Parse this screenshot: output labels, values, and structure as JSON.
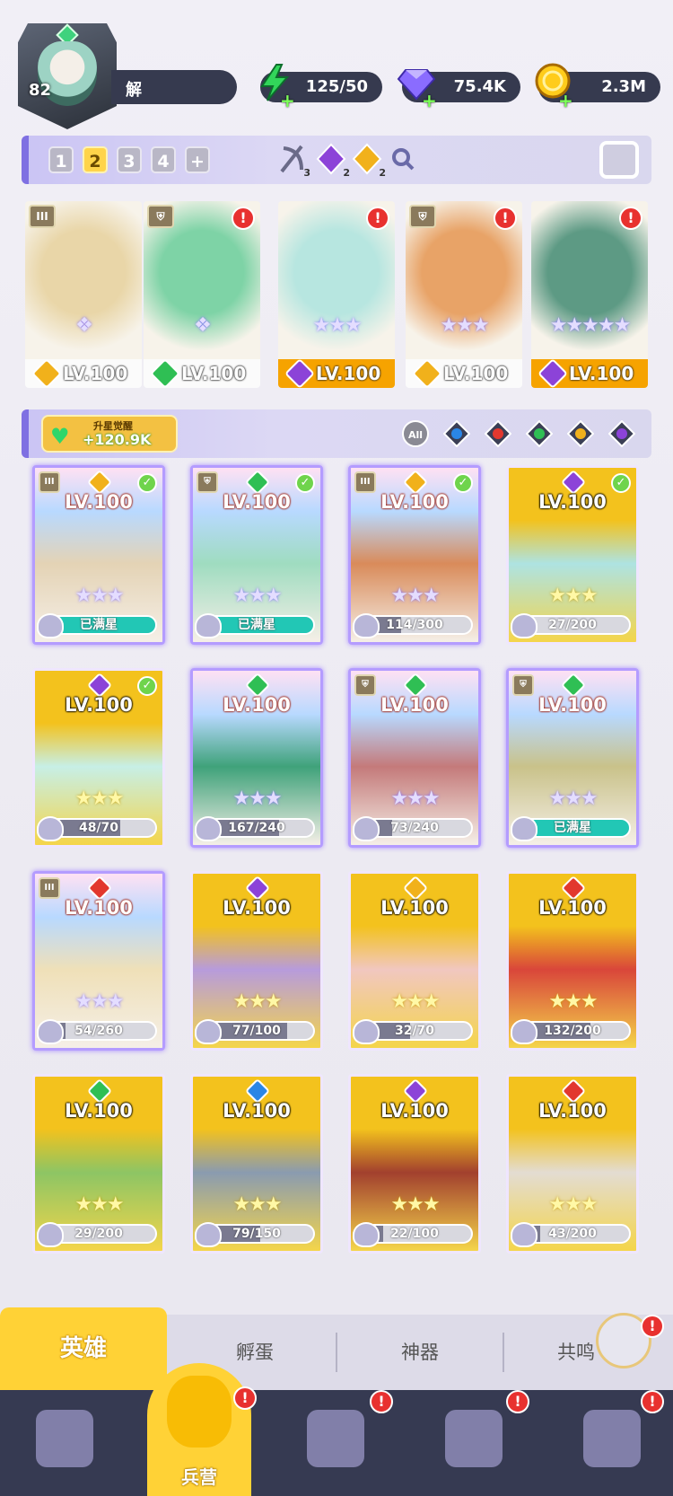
{
  "player": {
    "level": "82",
    "name": "解"
  },
  "resources": [
    {
      "name": "energy",
      "icon": "lightning-icon",
      "value": "125/50",
      "color": "#32d65a"
    },
    {
      "name": "gems",
      "icon": "diamond-icon",
      "value": "75.4K",
      "color": "#8a6cff"
    },
    {
      "name": "gold",
      "icon": "coin-icon",
      "value": "2.3M",
      "color": "#ffcc1c"
    }
  ],
  "team_tabs": [
    "1",
    "2",
    "3",
    "4",
    "+"
  ],
  "team_active_index": 1,
  "team_stats": [
    {
      "icon": "bow-icon",
      "count": "3"
    },
    {
      "icon": "moon-element-icon",
      "count": "2"
    },
    {
      "icon": "light-element-icon",
      "count": "2"
    },
    {
      "icon": "magnifier-icon",
      "count": ""
    }
  ],
  "team": [
    {
      "level": "LV.100",
      "element": "light",
      "tier": "III",
      "stars": 0,
      "alert": false,
      "style": "white",
      "art": "#e9d6a8"
    },
    {
      "level": "LV.100",
      "element": "nature",
      "tier": "shield",
      "stars": 0,
      "alert": true,
      "style": "white",
      "art": "#7ed3a6"
    },
    {
      "level": "LV.100",
      "element": "moon",
      "tier": "",
      "stars": 3,
      "alert": true,
      "style": "gold",
      "art": "#b7e6e0"
    },
    {
      "level": "LV.100",
      "element": "light",
      "tier": "shield",
      "stars": 3,
      "alert": true,
      "style": "white",
      "art": "#e8a367"
    },
    {
      "level": "LV.100",
      "element": "moon",
      "tier": "",
      "stars": 5,
      "alert": true,
      "style": "gold",
      "art": "#5d9a84"
    }
  ],
  "awaken": {
    "label": "升星觉醒",
    "value": "+120.9K"
  },
  "filters": [
    "All",
    "water",
    "fire",
    "nature",
    "light",
    "moon"
  ],
  "element_colors": {
    "light": "#f1b11b",
    "nature": "#2fbf54",
    "moon": "#8c43d8",
    "fire": "#e2382e",
    "water": "#2a86e6"
  },
  "heroes": [
    {
      "level": "LV.100",
      "element": "light",
      "tier": "III",
      "check": true,
      "progress": "已满星",
      "ratio": 1,
      "full": true,
      "style": "sel",
      "art": "#e4d3b5"
    },
    {
      "level": "LV.100",
      "element": "nature",
      "tier": "shield",
      "check": true,
      "progress": "已满星",
      "ratio": 1,
      "full": true,
      "style": "sel",
      "art": "#9fdcc0"
    },
    {
      "level": "LV.100",
      "element": "light",
      "tier": "III",
      "check": true,
      "progress": "114/300",
      "ratio": 0.38,
      "full": false,
      "style": "sel",
      "art": "#d98b5a"
    },
    {
      "level": "LV.100",
      "element": "moon",
      "tier": "",
      "check": true,
      "progress": "27/200",
      "ratio": 0.135,
      "full": false,
      "style": "gold",
      "art": "#aee3e2"
    },
    {
      "level": "LV.100",
      "element": "moon",
      "tier": "",
      "check": true,
      "progress": "48/70",
      "ratio": 0.69,
      "full": false,
      "style": "gold",
      "art": "#c7efe6"
    },
    {
      "level": "LV.100",
      "element": "nature",
      "tier": "",
      "check": false,
      "progress": "167/240",
      "ratio": 0.7,
      "full": false,
      "style": "sel",
      "art": "#3fa27a"
    },
    {
      "level": "LV.100",
      "element": "nature",
      "tier": "shield",
      "check": false,
      "progress": "73/240",
      "ratio": 0.3,
      "full": false,
      "style": "sel",
      "art": "#c47a7a"
    },
    {
      "level": "LV.100",
      "element": "nature",
      "tier": "shield",
      "check": false,
      "progress": "已满星",
      "ratio": 1,
      "full": true,
      "style": "sel",
      "art": "#c9c28a"
    },
    {
      "level": "LV.100",
      "element": "fire",
      "tier": "III",
      "check": false,
      "progress": "54/260",
      "ratio": 0.21,
      "full": false,
      "style": "sel",
      "art": "#efe0b8"
    },
    {
      "level": "LV.100",
      "element": "moon",
      "tier": "",
      "check": false,
      "progress": "77/100",
      "ratio": 0.77,
      "full": false,
      "style": "gold",
      "art": "#b79bdc"
    },
    {
      "level": "LV.100",
      "element": "light",
      "tier": "",
      "check": false,
      "progress": "32/70",
      "ratio": 0.46,
      "full": false,
      "style": "gold",
      "art": "#f1c7c0"
    },
    {
      "level": "LV.100",
      "element": "fire",
      "tier": "",
      "check": false,
      "progress": "132/200",
      "ratio": 0.66,
      "full": false,
      "style": "gold",
      "art": "#d9463a"
    },
    {
      "level": "LV.100",
      "element": "nature",
      "tier": "",
      "check": false,
      "progress": "29/200",
      "ratio": 0.145,
      "full": false,
      "style": "gold",
      "art": "#8dc564"
    },
    {
      "level": "LV.100",
      "element": "water",
      "tier": "",
      "check": false,
      "progress": "79/150",
      "ratio": 0.53,
      "full": false,
      "style": "gold",
      "art": "#8a9bb0"
    },
    {
      "level": "LV.100",
      "element": "moon",
      "tier": "",
      "check": false,
      "progress": "22/100",
      "ratio": 0.22,
      "full": false,
      "style": "gold",
      "art": "#a2402e"
    },
    {
      "level": "LV.100",
      "element": "fire",
      "tier": "",
      "check": false,
      "progress": "43/200",
      "ratio": 0.215,
      "full": false,
      "style": "gold",
      "art": "#e3dcd2"
    }
  ],
  "subtabs": [
    "英雄",
    "孵蛋",
    "神器",
    "共鸣"
  ],
  "nav": {
    "active_label": "兵营"
  }
}
